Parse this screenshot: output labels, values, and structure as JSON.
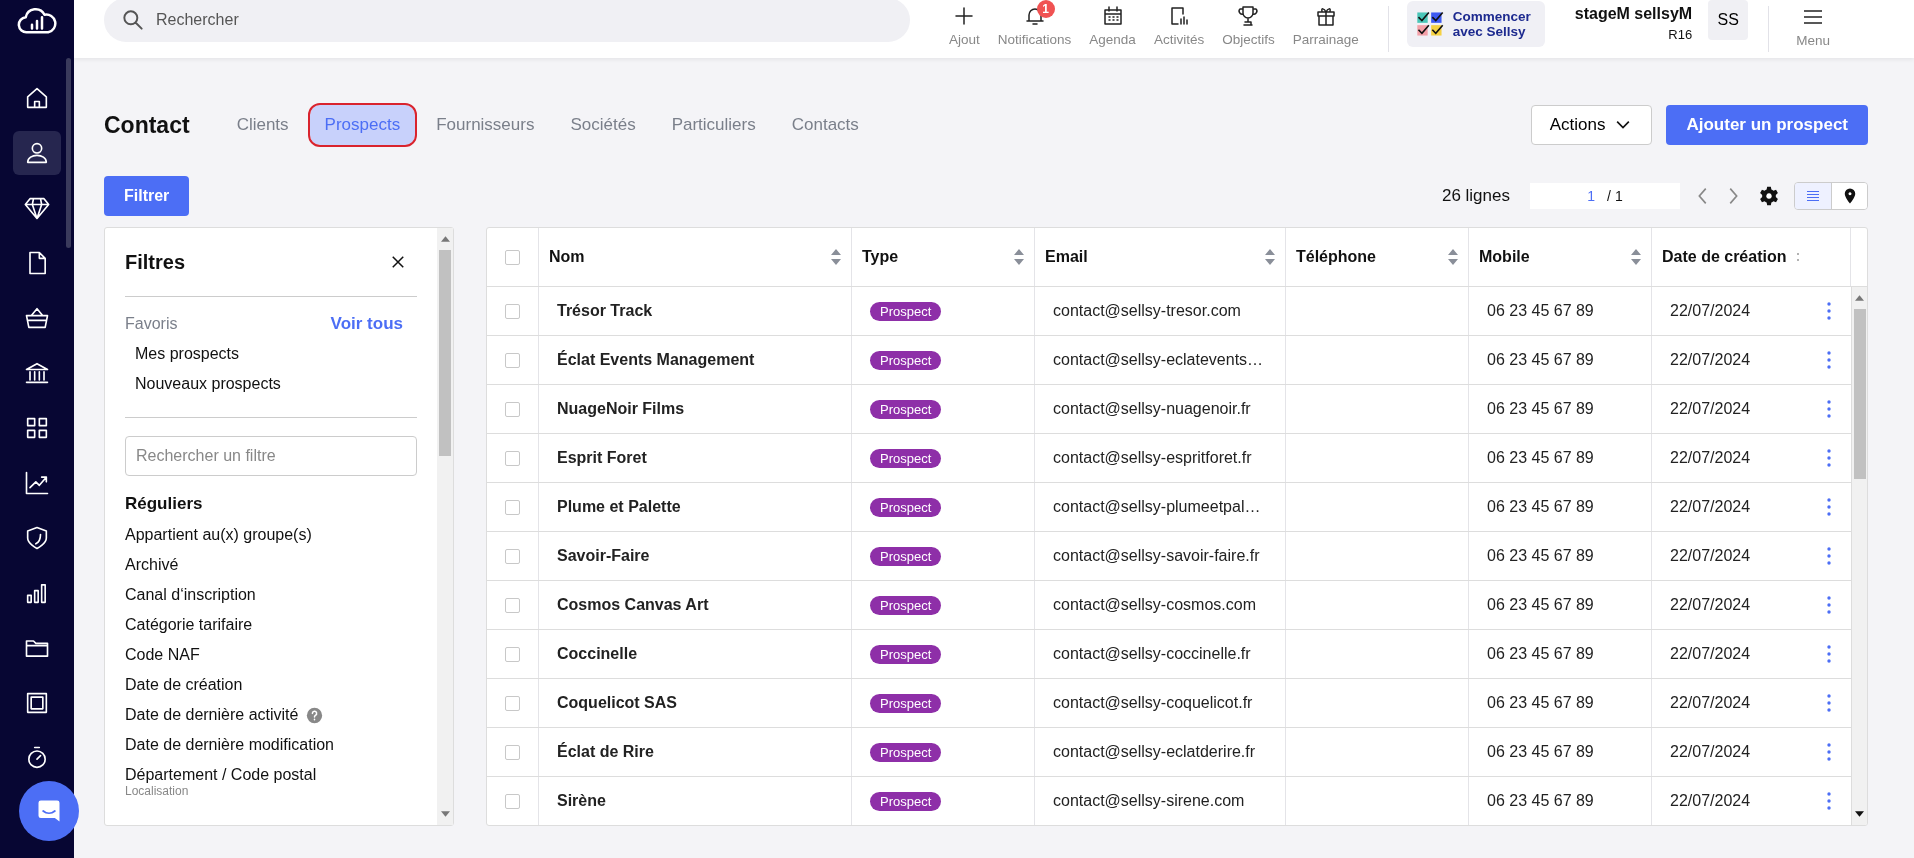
{
  "nav": [
    {
      "selected": false
    },
    {
      "selected": true
    },
    {
      "selected": false
    },
    {
      "selected": false
    },
    {
      "selected": false
    },
    {
      "selected": false
    },
    {
      "selected": false
    },
    {
      "selected": false
    },
    {
      "selected": false
    },
    {
      "selected": false
    },
    {
      "selected": false
    },
    {
      "selected": false
    },
    {
      "selected": false
    }
  ],
  "search": {
    "placeholder": "Rechercher"
  },
  "toolbar": [
    {
      "label": "Ajout"
    },
    {
      "label": "Notifications",
      "badge": "1"
    },
    {
      "label": "Agenda"
    },
    {
      "label": "Activités"
    },
    {
      "label": "Objectifs"
    },
    {
      "label": "Parrainage"
    }
  ],
  "onboarding": {
    "lines": [
      "Commencer",
      "avec Sellsy"
    ]
  },
  "user": {
    "name": "stageM sellsyM",
    "code": "R16",
    "initials": "SS"
  },
  "menu": {
    "label": "Menu"
  },
  "page": {
    "title": "Contact",
    "actions": "Actions",
    "add": "Ajouter un prospect",
    "filter": "Filtrer"
  },
  "tabs": [
    {
      "label": "Clients",
      "selected": false
    },
    {
      "label": "Prospects",
      "selected": true
    },
    {
      "label": "Fournisseurs",
      "selected": false
    },
    {
      "label": "Sociétés",
      "selected": false
    },
    {
      "label": "Particuliers",
      "selected": false
    },
    {
      "label": "Contacts",
      "selected": false
    }
  ],
  "pagination": {
    "count": "26 lignes",
    "page": "1",
    "total": "/ 1"
  },
  "view_toggle": [
    {
      "selected": true
    },
    {
      "selected": false
    }
  ],
  "filters": {
    "title": "Filtres",
    "favorites_label": "Favoris",
    "see_all": "Voir tous",
    "favorites": [
      "Mes prospects",
      "Nouveaux prospects"
    ],
    "search_placeholder": "Rechercher un filtre",
    "section": "Réguliers",
    "items": [
      {
        "label": "Appartient au(x) groupe(s)",
        "help": false
      },
      {
        "label": "Archivé",
        "help": false
      },
      {
        "label": "Canal d‘inscription",
        "help": false
      },
      {
        "label": "Catégorie tarifaire",
        "help": false
      },
      {
        "label": "Code NAF",
        "help": false
      },
      {
        "label": "Date de création",
        "help": false
      },
      {
        "label": "Date de dernière activité",
        "help": true
      },
      {
        "label": "Date de dernière modification",
        "help": false
      },
      {
        "label": "Département / Code postal",
        "help": false,
        "note": "Localisation"
      }
    ]
  },
  "table": {
    "all_checked": false,
    "columns": [
      {
        "label": "Nom",
        "sortable": true
      },
      {
        "label": "Type",
        "sortable": true
      },
      {
        "label": "Email",
        "sortable": true
      },
      {
        "label": "Téléphone",
        "sortable": true
      },
      {
        "label": "Mobile",
        "sortable": true
      },
      {
        "label": "Date de création",
        "sortable": false
      }
    ],
    "rows": [
      {
        "checked": false,
        "name": "Trésor Track",
        "type": "Prospect",
        "email": "contact@sellsy-tresor.com",
        "mobile": "06 23 45 67 89",
        "date": "22/07/2024"
      },
      {
        "checked": false,
        "name": "Éclat Events Management",
        "type": "Prospect",
        "email": "contact@sellsy-eclatevents…",
        "mobile": "06 23 45 67 89",
        "date": "22/07/2024"
      },
      {
        "checked": false,
        "name": "NuageNoir Films",
        "type": "Prospect",
        "email": "contact@sellsy-nuagenoir.fr",
        "mobile": "06 23 45 67 89",
        "date": "22/07/2024"
      },
      {
        "checked": false,
        "name": "Esprit Foret",
        "type": "Prospect",
        "email": "contact@sellsy-espritforet.fr",
        "mobile": "06 23 45 67 89",
        "date": "22/07/2024"
      },
      {
        "checked": false,
        "name": "Plume et Palette",
        "type": "Prospect",
        "email": "contact@sellsy-plumeetpal…",
        "mobile": "06 23 45 67 89",
        "date": "22/07/2024"
      },
      {
        "checked": false,
        "name": "Savoir-Faire",
        "type": "Prospect",
        "email": "contact@sellsy-savoir-faire.fr",
        "mobile": "06 23 45 67 89",
        "date": "22/07/2024"
      },
      {
        "checked": false,
        "name": "Cosmos Canvas Art",
        "type": "Prospect",
        "email": "contact@sellsy-cosmos.com",
        "mobile": "06 23 45 67 89",
        "date": "22/07/2024"
      },
      {
        "checked": false,
        "name": "Coccinelle",
        "type": "Prospect",
        "email": "contact@sellsy-coccinelle.fr",
        "mobile": "06 23 45 67 89",
        "date": "22/07/2024"
      },
      {
        "checked": false,
        "name": "Coquelicot SAS",
        "type": "Prospect",
        "email": "contact@sellsy-coquelicot.fr",
        "mobile": "06 23 45 67 89",
        "date": "22/07/2024"
      },
      {
        "checked": false,
        "name": "Éclat de Rire",
        "type": "Prospect",
        "email": "contact@sellsy-eclatderire.fr",
        "mobile": "06 23 45 67 89",
        "date": "22/07/2024"
      },
      {
        "checked": false,
        "name": "Sirène",
        "type": "Prospect",
        "email": "contact@sellsy-sirene.com",
        "mobile": "06 23 45 67 89",
        "date": "22/07/2024"
      }
    ]
  }
}
